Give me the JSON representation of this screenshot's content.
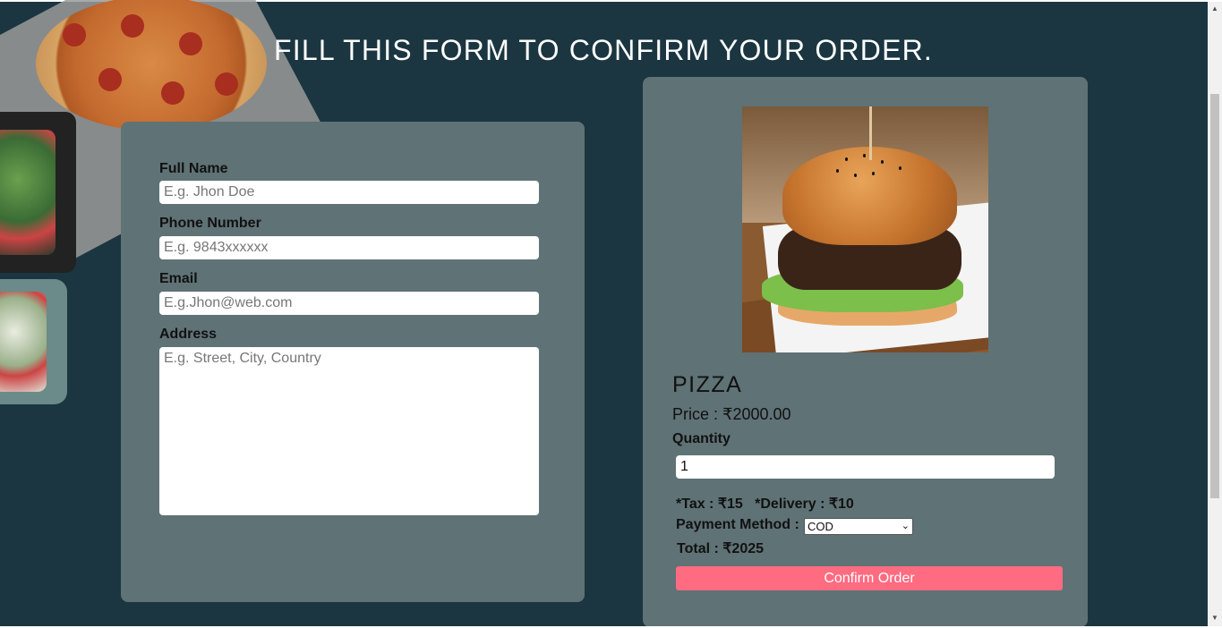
{
  "page": {
    "title": "FILL THIS FORM TO CONFIRM YOUR ORDER."
  },
  "form": {
    "full_name_label": "Full Name",
    "full_name_placeholder": "E.g. Jhon Doe",
    "phone_label": "Phone Number",
    "phone_placeholder": "E.g. 9843xxxxxx",
    "email_label": "Email",
    "email_placeholder": "E.g.Jhon@web.com",
    "address_label": "Address",
    "address_placeholder": "E.g. Street, City, Country"
  },
  "order": {
    "product_name": "PIZZA",
    "price_text": "Price : ₹2000.00",
    "quantity_label": "Quantity",
    "quantity_value": "1",
    "fees_text": "*Tax : ₹15   *Delivery : ₹10",
    "payment_label": "Payment Method :",
    "payment_selected": "COD",
    "total_text": "Total : ₹2025",
    "confirm_label": "Confirm Order"
  },
  "colors": {
    "background": "#1b3640",
    "panel": "#5f7276",
    "button": "#ff6b81"
  },
  "icons": {
    "select_chevron": "chevron-down-icon",
    "scroll_up": "arrow-up-icon",
    "scroll_down": "arrow-down-icon"
  }
}
